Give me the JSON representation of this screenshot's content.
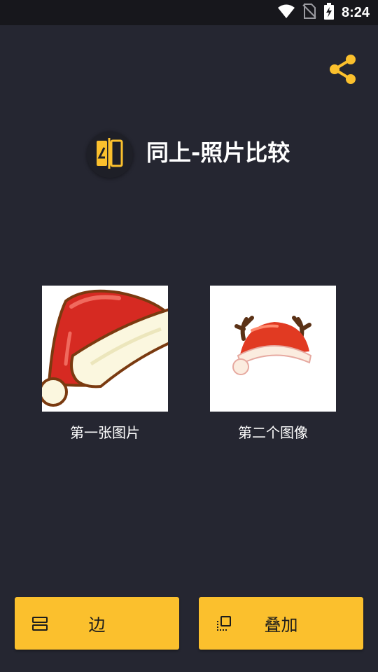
{
  "status_bar": {
    "time": "8:24",
    "icons": [
      "wifi-icon",
      "no-sim-icon",
      "battery-charging-icon"
    ]
  },
  "header": {
    "share_icon": "share-icon",
    "logo_icon": "compare-logo-icon",
    "title": "同上-照片比较"
  },
  "images": [
    {
      "label": "第一张图片",
      "content": "santa-hat"
    },
    {
      "label": "第二个图像",
      "content": "antler-santa-hat"
    }
  ],
  "actions": [
    {
      "label": "边",
      "icon": "side-by-side-icon"
    },
    {
      "label": "叠加",
      "icon": "overlay-icon"
    }
  ],
  "colors": {
    "background": "#252631",
    "status_bar": "#17171c",
    "accent": "#fbc02d",
    "text": "#ffffff"
  }
}
